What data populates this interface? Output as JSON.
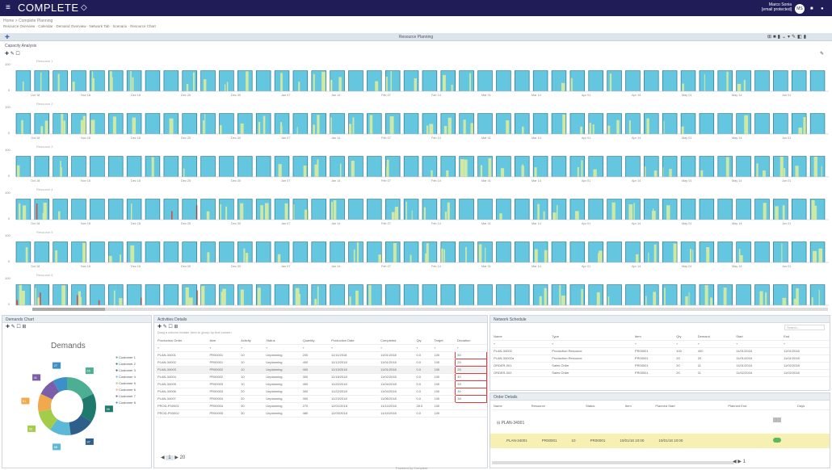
{
  "app": {
    "logo": "COMPLETE",
    "user_name": "Marco Sonia",
    "user_email": "[email protected]",
    "avatar": "MS"
  },
  "breadcrumb": "Home > Complete Planning",
  "toolbar_links": [
    "Resource Overview",
    "Calendar",
    "Demand Overview",
    "Network Tab",
    "Scenario",
    "Resource Chart"
  ],
  "view_title": "Resource Planning",
  "top_tab": "Capacity Analysis",
  "chart_data": [
    {
      "type": "bar",
      "title": "Resource 1",
      "ylim": [
        0,
        100
      ],
      "x_ticks": [
        "Oct 18",
        "Nov 18",
        "Dec 18",
        "Dec 25",
        "Dec 30",
        "Jan 07",
        "Jan 14",
        "Feb 07",
        "Feb 14",
        "Mar 01",
        "Mar 14",
        "Apr 01",
        "Apr 14",
        "May 01",
        "May 14",
        "Jun 01"
      ]
    },
    {
      "type": "bar",
      "title": "Resource 2",
      "ylim": [
        0,
        100
      ],
      "x_ticks": [
        "Oct 18",
        "Nov 18",
        "Dec 18",
        "Dec 25",
        "Dec 30",
        "Jan 07",
        "Jan 14",
        "Feb 07",
        "Feb 14",
        "Mar 01",
        "Mar 14",
        "Apr 01",
        "Apr 14",
        "May 01",
        "May 14",
        "Jun 01"
      ]
    },
    {
      "type": "bar",
      "title": "Resource 3",
      "ylim": [
        0,
        100
      ],
      "x_ticks": [
        "Oct 18",
        "Nov 18",
        "Dec 18",
        "Dec 25",
        "Dec 30",
        "Jan 07",
        "Jan 14",
        "Feb 07",
        "Feb 14",
        "Mar 01",
        "Mar 14",
        "Apr 01",
        "Apr 14",
        "May 01",
        "May 14",
        "Jun 01"
      ]
    },
    {
      "type": "bar",
      "title": "Resource 4",
      "ylim": [
        0,
        100
      ],
      "x_ticks": [
        "Oct 18",
        "Nov 18",
        "Dec 18",
        "Dec 25",
        "Dec 30",
        "Jan 07",
        "Jan 14",
        "Feb 07",
        "Feb 14",
        "Mar 01",
        "Mar 14",
        "Apr 01",
        "Apr 14",
        "May 01",
        "May 14",
        "Jun 01"
      ]
    },
    {
      "type": "bar",
      "title": "Resource 5",
      "ylim": [
        0,
        100
      ],
      "x_ticks": [
        "Oct 18",
        "Nov 18",
        "Dec 18",
        "Dec 25",
        "Dec 30",
        "Jan 07",
        "Jan 14",
        "Feb 07",
        "Feb 14",
        "Mar 01",
        "Mar 14",
        "Apr 01",
        "Apr 14",
        "May 01",
        "May 14",
        "Jun 01"
      ]
    },
    {
      "type": "bar",
      "title": "Resource 6",
      "ylim": [
        0,
        100
      ],
      "x_ticks": [
        "Oct 18",
        "Nov 18",
        "Dec 18",
        "Dec 25",
        "Dec 30",
        "Jan 07",
        "Jan 14",
        "Feb 07",
        "Feb 14",
        "Mar 01",
        "Mar 14",
        "Apr 01",
        "Apr 14",
        "May 01",
        "May 14",
        "Jun 01"
      ]
    }
  ],
  "demands_panel": {
    "tab": "Demands Chart",
    "title": "Demands",
    "donut": {
      "type": "pie",
      "values": [
        18,
        16,
        14,
        12,
        12,
        10,
        10,
        8
      ],
      "colors": [
        "#4caf93",
        "#1f7a6e",
        "#2e5f8a",
        "#5bb8d6",
        "#a3cc4b",
        "#f0a94b",
        "#7b5ea7",
        "#3d8ec9"
      ],
      "labels": [
        "65",
        "35",
        "97",
        "88",
        "53",
        "51",
        "41",
        "27"
      ]
    },
    "legend": [
      "Customer 1",
      "Customer 2",
      "Customer 3",
      "Customer 4",
      "Customer 5",
      "Customer 6",
      "Customer 7",
      "Customer 8"
    ]
  },
  "activities_panel": {
    "tab": "Activities Details",
    "info": "Drag a column header here to group by that column",
    "headers": [
      "Production Order",
      "Item",
      "Activity",
      "Status",
      "Quantity",
      "Production Date",
      "Completed",
      "Qty",
      "Target",
      "Deviation"
    ],
    "rows": [
      [
        "PLAN-34001",
        "PR00001",
        "10",
        "Unplanning",
        "200",
        "11/11/2018",
        "11/01/2018",
        "0.0",
        "100",
        "50"
      ],
      [
        "PLAN-34002",
        "PR00001",
        "10",
        "Unplanning",
        "400",
        "11/12/2018",
        "11/01/2018",
        "0.0",
        "100",
        "25"
      ],
      [
        "PLAN-34003",
        "PR00002",
        "10",
        "Unplanning",
        "400",
        "11/13/2018",
        "11/01/2018",
        "0.0",
        "100",
        "25"
      ],
      [
        "PLAN-34004",
        "PR00002",
        "10",
        "Unplanning",
        "300",
        "11/18/2018",
        "11/02/2018",
        "0.0",
        "100",
        "40"
      ],
      [
        "PLAN-34005",
        "PR00003",
        "10",
        "Unplanning",
        "400",
        "11/20/2018",
        "11/04/2018",
        "0.0",
        "100",
        "33"
      ],
      [
        "PLAN-34006",
        "PR00003",
        "20",
        "Unplanning",
        "300",
        "11/22/2018",
        "11/04/2018",
        "0.0",
        "100",
        "30"
      ],
      [
        "PLAN-34007",
        "PR00004",
        "20",
        "Unplanning",
        "300",
        "11/23/2018",
        "11/06/2018",
        "0.0",
        "100",
        "38"
      ],
      [
        "PROD-P00001",
        "PR00004",
        "30",
        "Unplanning",
        "270",
        "12/01/2018",
        "11/14/2018",
        "28.0",
        "100",
        ""
      ],
      [
        "PROD-P00002",
        "PR00005",
        "30",
        "Unplanning",
        "480",
        "12/03/2018",
        "11/15/2018",
        "0.0",
        "100",
        ""
      ]
    ],
    "pager": "1",
    "pager_size": "20"
  },
  "network_panel": {
    "tab": "Network Schedule",
    "search": "Search...",
    "headers": [
      "Name",
      "Type",
      "Item",
      "Qty",
      "Demand",
      "Start",
      "End"
    ],
    "rows": [
      [
        "PLAN-34002",
        "Production Resource",
        "PR00001",
        "100",
        "400",
        "11/01/2018",
        "11/01/2018"
      ],
      [
        "PLAN-34002a",
        "Production Resource",
        "PR00001",
        "20",
        "20",
        "11/01/2018",
        "11/01/2018"
      ],
      [
        "ORDER-001",
        "Sales Order",
        "PR00001",
        "20",
        "11",
        "11/01/2018",
        "11/02/2018"
      ],
      [
        "ORDER-002",
        "Sales Order",
        "PR00001",
        "20",
        "11",
        "11/02/2018",
        "11/02/2018"
      ]
    ]
  },
  "order_panel": {
    "tab": "Order Details",
    "headers": [
      "Name",
      "Resource",
      "Status",
      "Item",
      "Planned Start",
      "Planned End",
      "Days"
    ],
    "group": "PLAN-34001",
    "row": [
      "PLAN-34001",
      "PR00001",
      "10",
      "PR00001",
      "10/01/18 10:00",
      "10/01/18 10:00"
    ],
    "pager": "1"
  },
  "footer": "Powered by Complete"
}
